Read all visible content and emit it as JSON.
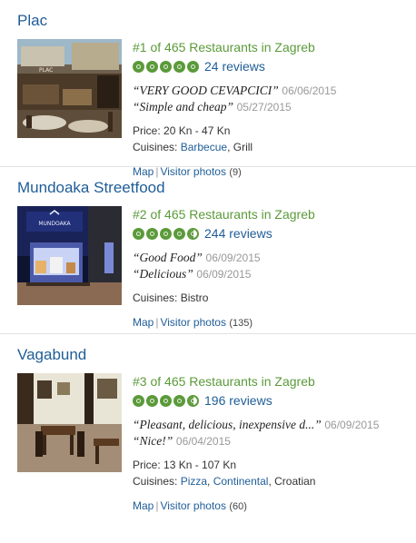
{
  "restaurants": [
    {
      "name": "Plac",
      "rank_text": "#1 of 465 Restaurants in Zagreb",
      "rating": 5,
      "reviews_text": "24 reviews",
      "quotes": [
        {
          "text": "VERY GOOD CEVAPCICI",
          "date": "06/06/2015"
        },
        {
          "text": "Simple and cheap",
          "date": "05/27/2015"
        }
      ],
      "price_label": "Price:",
      "price": "20 Kn - 47 Kn",
      "cuisines_label": "Cuisines:",
      "cuisines": [
        {
          "name": "Barbecue",
          "link": true
        },
        {
          "name": "Grill",
          "link": false
        }
      ],
      "map_label": "Map",
      "photos_label": "Visitor photos",
      "photos_count": "(9)"
    },
    {
      "name": "Mundoaka Streetfood",
      "rank_text": "#2 of 465 Restaurants in Zagreb",
      "rating": 4.5,
      "reviews_text": "244 reviews",
      "quotes": [
        {
          "text": "Good Food",
          "date": "06/09/2015"
        },
        {
          "text": "Delicious",
          "date": "06/09/2015"
        }
      ],
      "cuisines_label": "Cuisines:",
      "cuisines": [
        {
          "name": "Bistro",
          "link": false
        }
      ],
      "map_label": "Map",
      "photos_label": "Visitor photos",
      "photos_count": "(135)",
      "sign_text": "MUNDOAKA"
    },
    {
      "name": "Vagabund",
      "rank_text": "#3 of 465 Restaurants in Zagreb",
      "rating": 4.5,
      "reviews_text": "196 reviews",
      "quotes": [
        {
          "text": "Pleasant, delicious, inexpensive d...",
          "date": "06/09/2015"
        },
        {
          "text": "Nice!",
          "date": "06/04/2015"
        }
      ],
      "price_label": "Price:",
      "price": "13 Kn - 107 Kn",
      "cuisines_label": "Cuisines:",
      "cuisines": [
        {
          "name": "Pizza",
          "link": true
        },
        {
          "name": "Continental",
          "link": true
        },
        {
          "name": "Croatian",
          "link": false
        }
      ],
      "map_label": "Map",
      "photos_label": "Visitor photos",
      "photos_count": "(60)"
    }
  ]
}
